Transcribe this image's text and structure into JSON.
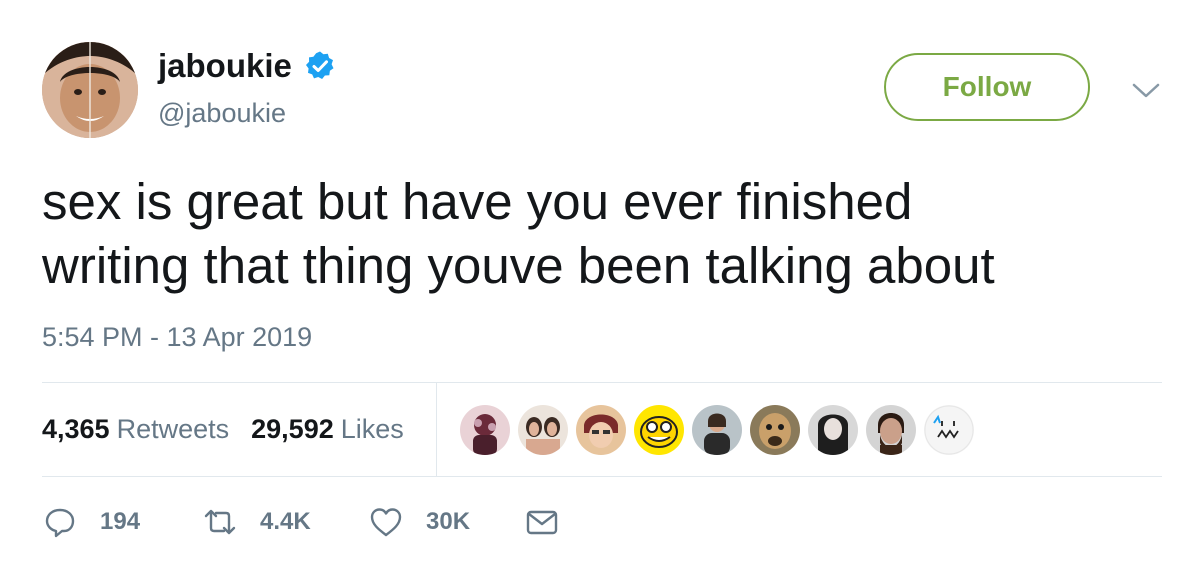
{
  "user": {
    "display_name": "jaboukie",
    "handle": "@jaboukie",
    "verified": true
  },
  "header": {
    "follow_label": "Follow",
    "menu_icon": "chevron-down-icon"
  },
  "tweet": {
    "text_line1": "sex is great but have you ever finished",
    "text_line2": "writing that thing youve been talking about",
    "timestamp": "5:54 PM - 13 Apr 2019"
  },
  "stats": {
    "retweets_count": "4,365",
    "retweets_label": "Retweets",
    "likes_count": "29,592",
    "likes_label": "Likes"
  },
  "actions": {
    "reply_count": "194",
    "retweet_count": "4.4K",
    "like_count": "30K"
  },
  "colors": {
    "follow_green": "#7ba944",
    "verified_blue": "#1da1f2",
    "text_primary": "#14171a",
    "text_secondary": "#657786",
    "divider": "#e1e8ed"
  }
}
